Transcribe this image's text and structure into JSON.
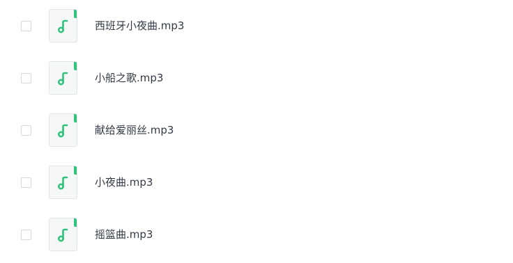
{
  "file_icon": "music-note-icon",
  "accent_color": "#32c27d",
  "files": [
    {
      "name": "西班牙小夜曲.mp3",
      "checked": false
    },
    {
      "name": "小船之歌.mp3",
      "checked": false
    },
    {
      "name": "献给爱丽丝.mp3",
      "checked": false
    },
    {
      "name": "小夜曲.mp3",
      "checked": false
    },
    {
      "name": "摇篮曲.mp3",
      "checked": false
    }
  ]
}
